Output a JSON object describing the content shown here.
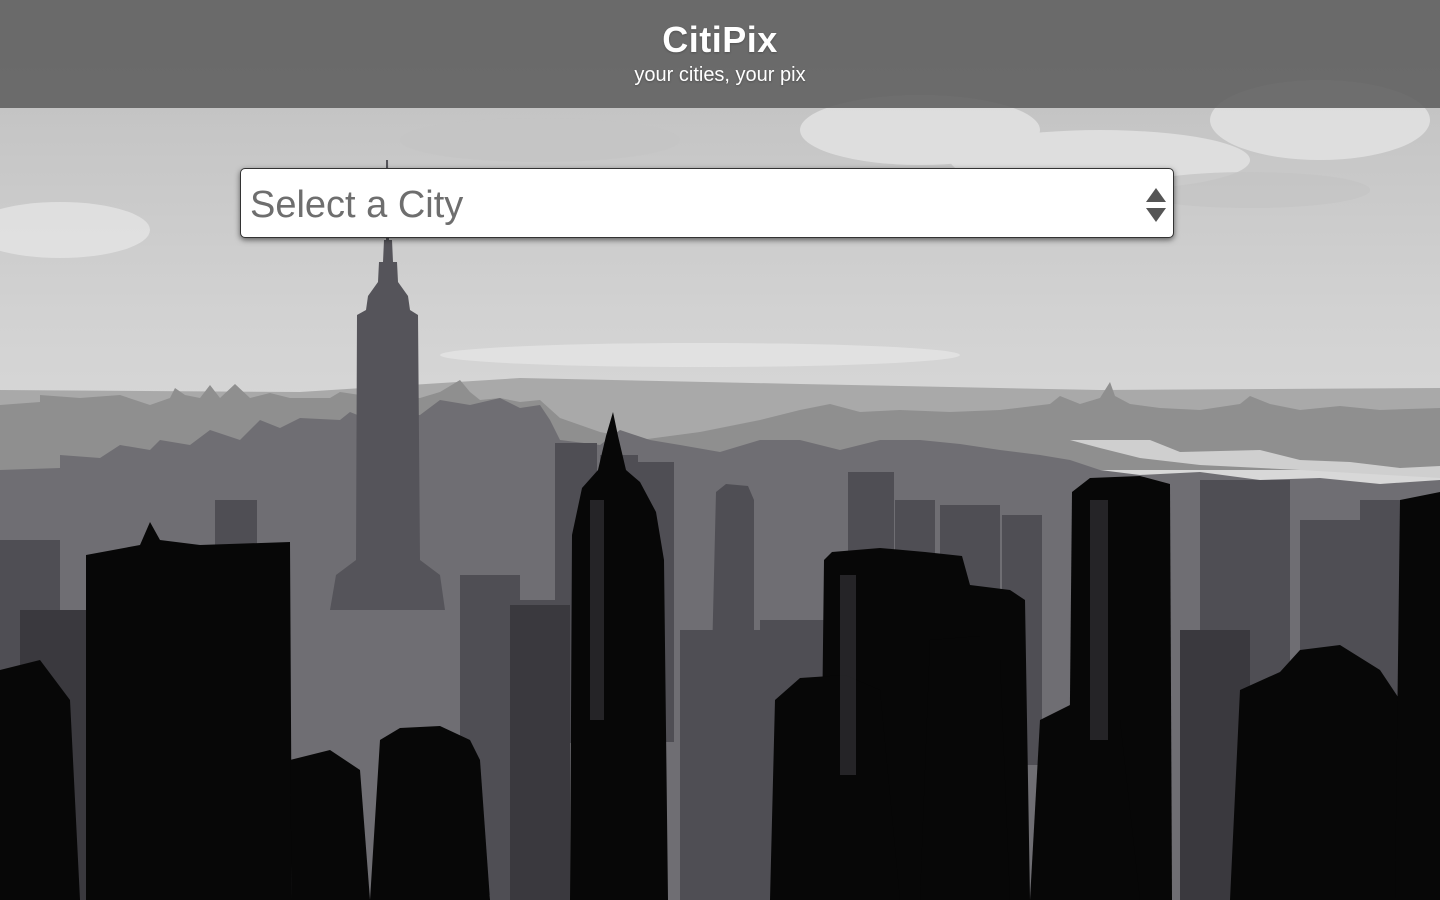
{
  "header": {
    "title": "CitiPix",
    "tagline": "your cities, your pix"
  },
  "city_select": {
    "selected_value": "Select a City"
  },
  "background": {
    "description_icon": "city-skyline-image"
  },
  "colors": {
    "header_bg": "#5c5c5c",
    "header_text": "#ffffff",
    "select_text": "#6e6e6e"
  }
}
